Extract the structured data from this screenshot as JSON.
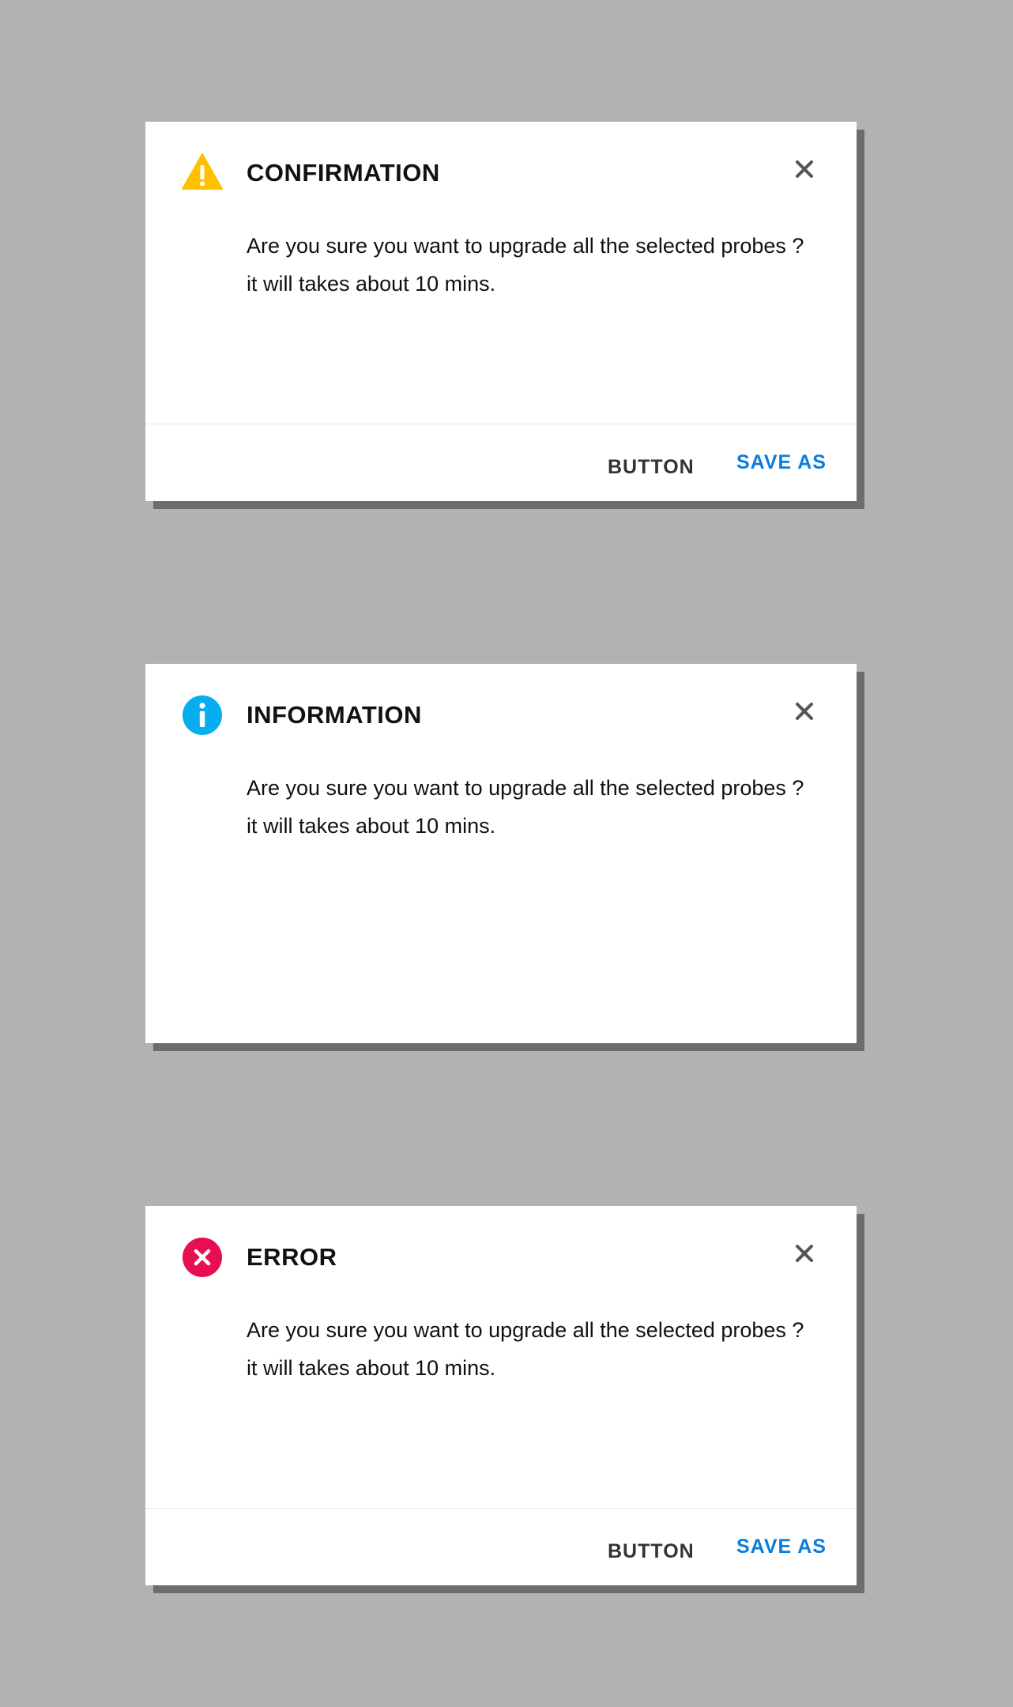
{
  "colors": {
    "background": "#b2b2b2",
    "dialog_background": "#ffffff",
    "shadow": "#6d6d6d",
    "warning": "#ffc000",
    "info": "#06aeef",
    "error": "#e80e52",
    "primary_action": "#0a7ddc"
  },
  "dialogs": [
    {
      "type": "confirmation",
      "icon": "warning-icon",
      "title": "CONFIRMATION",
      "message_line1": "Are you sure you want to upgrade all the selected probes ?",
      "message_line2": "it will takes about 10 mins.",
      "secondary_button": "BUTTON",
      "primary_button": "SAVE AS"
    },
    {
      "type": "information",
      "icon": "info-icon",
      "title": "INFORMATION",
      "message_line1": "Are you sure you want to upgrade all the selected probes ?",
      "message_line2": "it will takes about 10 mins."
    },
    {
      "type": "error",
      "icon": "error-icon",
      "title": "ERROR",
      "message_line1": "Are you sure you want to upgrade all the selected probes ?",
      "message_line2": "it will takes about 10 mins.",
      "secondary_button": "BUTTON",
      "primary_button": "SAVE AS"
    }
  ]
}
